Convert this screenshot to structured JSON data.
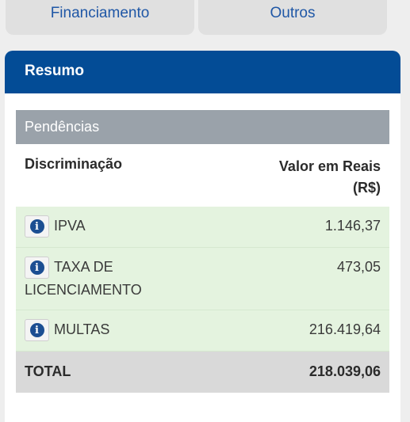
{
  "tabs": [
    {
      "label": "Financiamento"
    },
    {
      "label": "Outros"
    }
  ],
  "summary": {
    "title": "Resumo",
    "section_title": "Pendências",
    "columns": {
      "description": "Discriminação",
      "value_line1": "Valor em Reais",
      "value_line2": "(R$)"
    },
    "rows": [
      {
        "label": "IPVA",
        "value": "1.146,37",
        "icon": "info-icon"
      },
      {
        "label": "TAXA DE LICENCIAMENTO",
        "value": "473,05",
        "icon": "info-icon"
      },
      {
        "label": "MULTAS",
        "value": "216.419,64",
        "icon": "info-icon"
      }
    ],
    "total": {
      "label": "TOTAL",
      "value": "218.039,06"
    }
  },
  "colors": {
    "header_blue": "#034c96",
    "tab_text": "#1f57a6",
    "section_gray": "#9aa2aa",
    "row_green": "#e4f3df",
    "total_gray": "#d9d9d9"
  }
}
